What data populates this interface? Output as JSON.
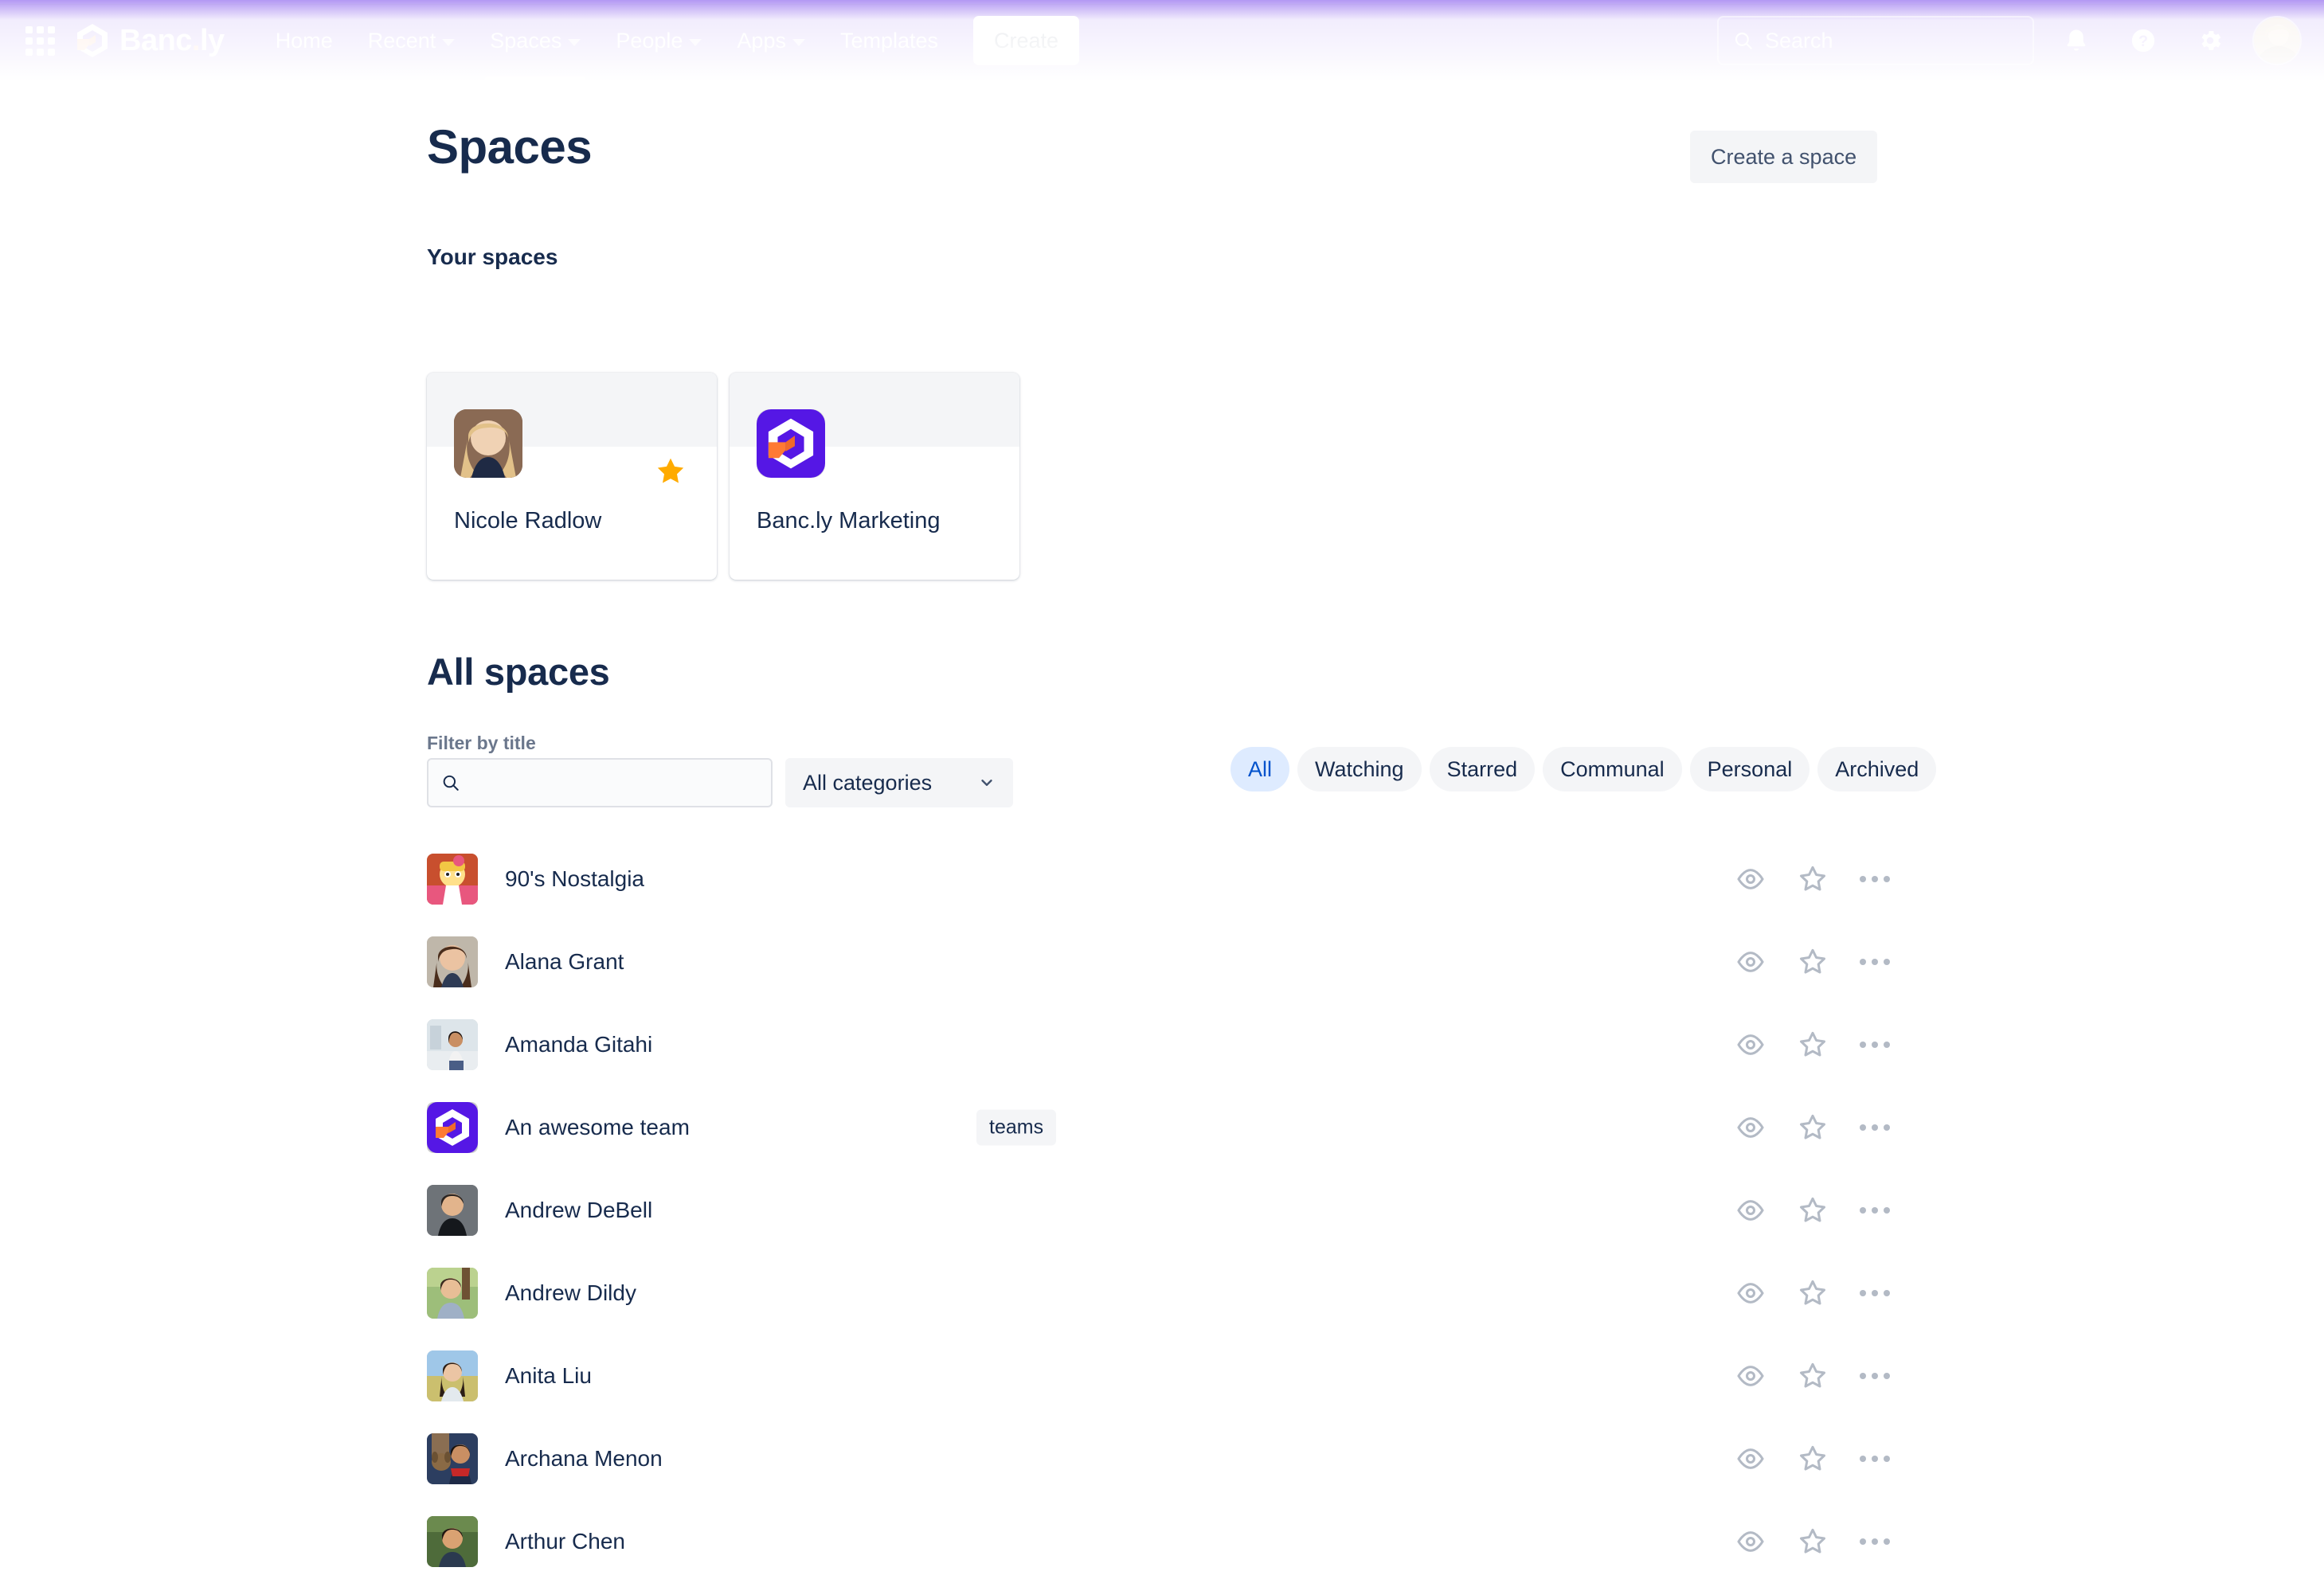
{
  "nav": {
    "app_switcher_icon": "grid-apps-icon",
    "brand": {
      "name_main": "Banc",
      "dot": ".",
      "name_suffix": "ly",
      "logo_icon": "bancly-cube-logo"
    },
    "links": [
      {
        "label": "Home",
        "has_chevron": false,
        "active": false
      },
      {
        "label": "Recent",
        "has_chevron": true,
        "active": false
      },
      {
        "label": "Spaces",
        "has_chevron": true,
        "active": true
      },
      {
        "label": "People",
        "has_chevron": true,
        "active": false
      },
      {
        "label": "Apps",
        "has_chevron": true,
        "active": false
      },
      {
        "label": "Templates",
        "has_chevron": false,
        "active": false
      }
    ],
    "create_label": "Create",
    "search": {
      "placeholder": "Search",
      "value": "",
      "icon": "search-icon"
    },
    "right_icons": [
      {
        "name": "notifications-bell-icon"
      },
      {
        "name": "help-question-icon"
      },
      {
        "name": "settings-gear-icon"
      }
    ],
    "profile_avatar": "user-avatar"
  },
  "header": {
    "title": "Spaces",
    "create_space_label": "Create a space"
  },
  "your_spaces": {
    "label": "Your spaces",
    "cards": [
      {
        "title": "Nicole Radlow",
        "starred": true,
        "avatar_kind": "photo-woman-blonde"
      },
      {
        "title": "Banc.ly Marketing",
        "starred": false,
        "avatar_kind": "bancly-logo"
      }
    ]
  },
  "all_spaces": {
    "title": "All spaces",
    "filter_label": "Filter by title",
    "filter_placeholder": "",
    "filter_value": "",
    "filter_icon": "search-icon",
    "categories_value": "All categories",
    "categories_chevron": "chevron-down-icon",
    "pills": [
      {
        "label": "All",
        "selected": true
      },
      {
        "label": "Watching",
        "selected": false
      },
      {
        "label": "Starred",
        "selected": false
      },
      {
        "label": "Communal",
        "selected": false
      },
      {
        "label": "Personal",
        "selected": false
      },
      {
        "label": "Archived",
        "selected": false
      }
    ],
    "row_actions": [
      {
        "name": "watch-eye-icon"
      },
      {
        "name": "star-outline-icon"
      },
      {
        "name": "more-actions-icon"
      }
    ],
    "rows": [
      {
        "name": "90's Nostalgia",
        "category": "",
        "avatar_kind": "cartoon-helga"
      },
      {
        "name": "Alana Grant",
        "category": "",
        "avatar_kind": "photo-woman-brunette"
      },
      {
        "name": "Amanda Gitahi",
        "category": "",
        "avatar_kind": "photo-woman-hallway"
      },
      {
        "name": "An awesome team",
        "category": "teams",
        "avatar_kind": "bancly-logo"
      },
      {
        "name": "Andrew DeBell",
        "category": "",
        "avatar_kind": "photo-man-dark"
      },
      {
        "name": "Andrew Dildy",
        "category": "",
        "avatar_kind": "photo-man-outdoor"
      },
      {
        "name": "Anita Liu",
        "category": "",
        "avatar_kind": "photo-woman-field"
      },
      {
        "name": "Archana Menon",
        "category": "",
        "avatar_kind": "photo-woman-dog"
      },
      {
        "name": "Arthur Chen",
        "category": "",
        "avatar_kind": "photo-man-green"
      }
    ]
  },
  "colors": {
    "brand_purple": "#5517E5",
    "brand_orange": "#FF7A33",
    "text_primary": "#172B4D",
    "text_subtle": "#6B778C",
    "pill_selected_bg": "#DEEBFF",
    "pill_selected_text": "#0052CC",
    "neutral_bg": "#F4F5F7",
    "star_gold": "#FFAB00"
  }
}
